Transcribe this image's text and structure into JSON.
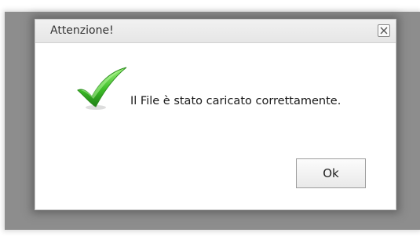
{
  "dialog": {
    "title": "Attenzione!",
    "message": "Il File è stato caricato correttamente.",
    "ok_label": "Ok",
    "icon": "checkmark-icon",
    "close_icon": "close-icon"
  },
  "colors": {
    "overlay": "#8d8d8d",
    "check_green": "#3fbf2a"
  }
}
